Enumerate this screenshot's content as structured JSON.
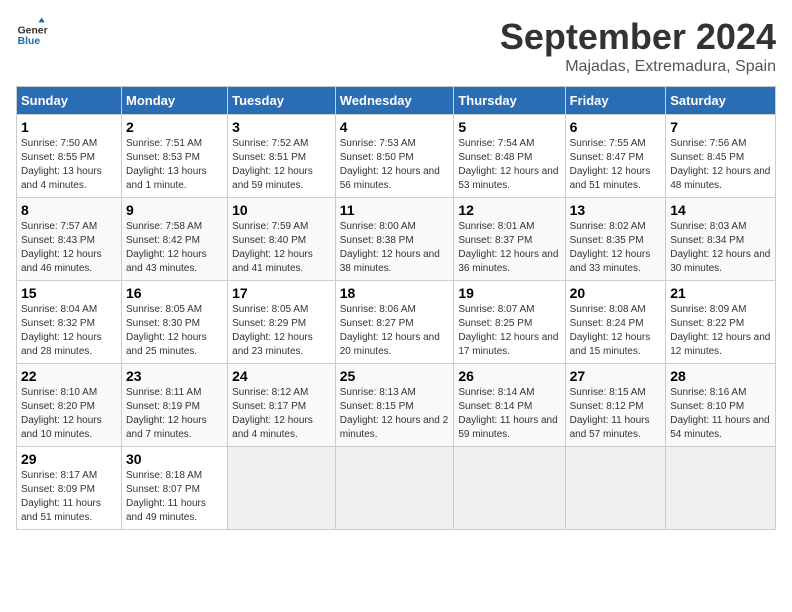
{
  "header": {
    "logo_line1": "General",
    "logo_line2": "Blue",
    "month": "September 2024",
    "location": "Majadas, Extremadura, Spain"
  },
  "weekdays": [
    "Sunday",
    "Monday",
    "Tuesday",
    "Wednesday",
    "Thursday",
    "Friday",
    "Saturday"
  ],
  "weeks": [
    [
      {
        "day": "1",
        "sunrise": "7:50 AM",
        "sunset": "8:55 PM",
        "daylight": "13 hours and 4 minutes."
      },
      {
        "day": "2",
        "sunrise": "7:51 AM",
        "sunset": "8:53 PM",
        "daylight": "13 hours and 1 minute."
      },
      {
        "day": "3",
        "sunrise": "7:52 AM",
        "sunset": "8:51 PM",
        "daylight": "12 hours and 59 minutes."
      },
      {
        "day": "4",
        "sunrise": "7:53 AM",
        "sunset": "8:50 PM",
        "daylight": "12 hours and 56 minutes."
      },
      {
        "day": "5",
        "sunrise": "7:54 AM",
        "sunset": "8:48 PM",
        "daylight": "12 hours and 53 minutes."
      },
      {
        "day": "6",
        "sunrise": "7:55 AM",
        "sunset": "8:47 PM",
        "daylight": "12 hours and 51 minutes."
      },
      {
        "day": "7",
        "sunrise": "7:56 AM",
        "sunset": "8:45 PM",
        "daylight": "12 hours and 48 minutes."
      }
    ],
    [
      {
        "day": "8",
        "sunrise": "7:57 AM",
        "sunset": "8:43 PM",
        "daylight": "12 hours and 46 minutes."
      },
      {
        "day": "9",
        "sunrise": "7:58 AM",
        "sunset": "8:42 PM",
        "daylight": "12 hours and 43 minutes."
      },
      {
        "day": "10",
        "sunrise": "7:59 AM",
        "sunset": "8:40 PM",
        "daylight": "12 hours and 41 minutes."
      },
      {
        "day": "11",
        "sunrise": "8:00 AM",
        "sunset": "8:38 PM",
        "daylight": "12 hours and 38 minutes."
      },
      {
        "day": "12",
        "sunrise": "8:01 AM",
        "sunset": "8:37 PM",
        "daylight": "12 hours and 36 minutes."
      },
      {
        "day": "13",
        "sunrise": "8:02 AM",
        "sunset": "8:35 PM",
        "daylight": "12 hours and 33 minutes."
      },
      {
        "day": "14",
        "sunrise": "8:03 AM",
        "sunset": "8:34 PM",
        "daylight": "12 hours and 30 minutes."
      }
    ],
    [
      {
        "day": "15",
        "sunrise": "8:04 AM",
        "sunset": "8:32 PM",
        "daylight": "12 hours and 28 minutes."
      },
      {
        "day": "16",
        "sunrise": "8:05 AM",
        "sunset": "8:30 PM",
        "daylight": "12 hours and 25 minutes."
      },
      {
        "day": "17",
        "sunrise": "8:05 AM",
        "sunset": "8:29 PM",
        "daylight": "12 hours and 23 minutes."
      },
      {
        "day": "18",
        "sunrise": "8:06 AM",
        "sunset": "8:27 PM",
        "daylight": "12 hours and 20 minutes."
      },
      {
        "day": "19",
        "sunrise": "8:07 AM",
        "sunset": "8:25 PM",
        "daylight": "12 hours and 17 minutes."
      },
      {
        "day": "20",
        "sunrise": "8:08 AM",
        "sunset": "8:24 PM",
        "daylight": "12 hours and 15 minutes."
      },
      {
        "day": "21",
        "sunrise": "8:09 AM",
        "sunset": "8:22 PM",
        "daylight": "12 hours and 12 minutes."
      }
    ],
    [
      {
        "day": "22",
        "sunrise": "8:10 AM",
        "sunset": "8:20 PM",
        "daylight": "12 hours and 10 minutes."
      },
      {
        "day": "23",
        "sunrise": "8:11 AM",
        "sunset": "8:19 PM",
        "daylight": "12 hours and 7 minutes."
      },
      {
        "day": "24",
        "sunrise": "8:12 AM",
        "sunset": "8:17 PM",
        "daylight": "12 hours and 4 minutes."
      },
      {
        "day": "25",
        "sunrise": "8:13 AM",
        "sunset": "8:15 PM",
        "daylight": "12 hours and 2 minutes."
      },
      {
        "day": "26",
        "sunrise": "8:14 AM",
        "sunset": "8:14 PM",
        "daylight": "11 hours and 59 minutes."
      },
      {
        "day": "27",
        "sunrise": "8:15 AM",
        "sunset": "8:12 PM",
        "daylight": "11 hours and 57 minutes."
      },
      {
        "day": "28",
        "sunrise": "8:16 AM",
        "sunset": "8:10 PM",
        "daylight": "11 hours and 54 minutes."
      }
    ],
    [
      {
        "day": "29",
        "sunrise": "8:17 AM",
        "sunset": "8:09 PM",
        "daylight": "11 hours and 51 minutes."
      },
      {
        "day": "30",
        "sunrise": "8:18 AM",
        "sunset": "8:07 PM",
        "daylight": "11 hours and 49 minutes."
      },
      null,
      null,
      null,
      null,
      null
    ]
  ]
}
